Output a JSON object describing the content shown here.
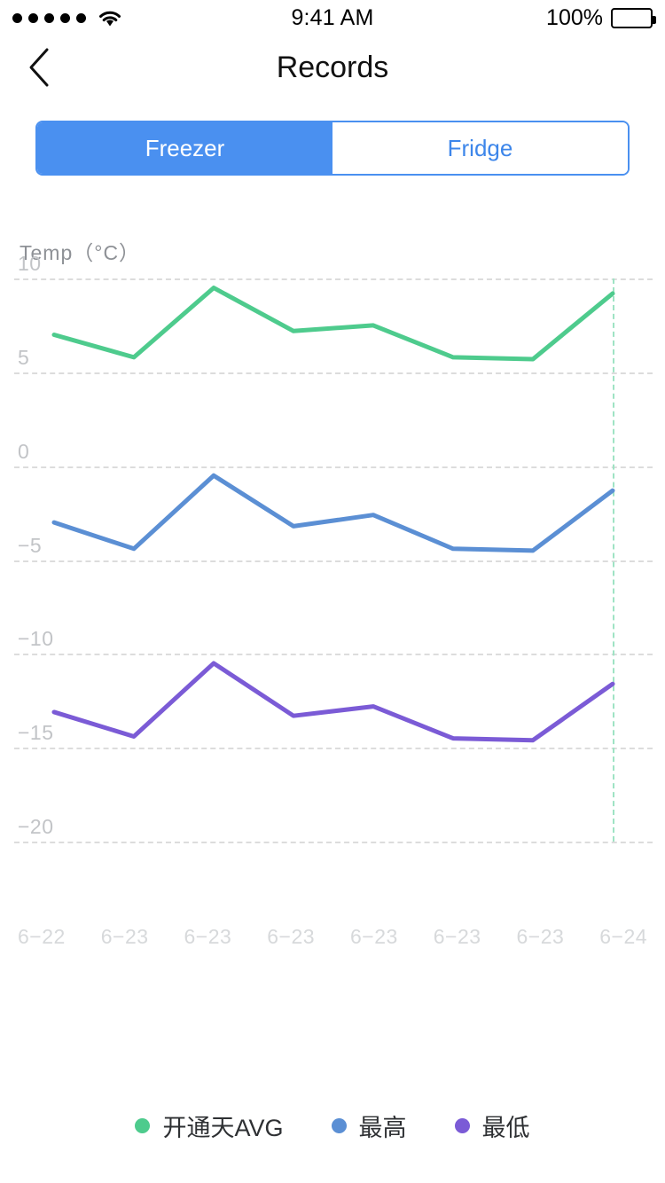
{
  "statusbar": {
    "signal_icon": "signal-dots",
    "wifi_icon": "wifi-icon",
    "time": "9:41 AM",
    "battery_percent": "100%",
    "battery_icon": "battery-full-icon"
  },
  "navbar": {
    "back_icon": "chevron-left-icon",
    "title": "Records"
  },
  "segmented": {
    "options": [
      {
        "label": "Freezer",
        "active": true
      },
      {
        "label": "Fridge",
        "active": false
      }
    ]
  },
  "colors": {
    "accent_blue": "#4a90f0",
    "avg_green": "#4ecb8d",
    "max_blue": "#5b8fd4",
    "min_purple": "#7b5bd6",
    "grid": "#dcdcdc",
    "marker": "#9fe3c4"
  },
  "chart_data": {
    "type": "line",
    "title": "",
    "ylabel": "Temp（°C）",
    "xlabel": "",
    "ylim": [
      -20,
      10
    ],
    "yticks": [
      10,
      5,
      0,
      -5,
      -10,
      -15,
      -20
    ],
    "ytick_labels": [
      "10",
      "5",
      "0",
      "−5",
      "−10",
      "−15",
      "−20"
    ],
    "grid": true,
    "legend_position": "bottom",
    "categories": [
      "6−22",
      "6−23",
      "6−23",
      "6−23",
      "6−23",
      "6−23",
      "6−23",
      "6−24"
    ],
    "marker_line_index": 7,
    "series": [
      {
        "name": "开通天AVG",
        "color": "#4ecb8d",
        "values": [
          7.0,
          5.8,
          9.5,
          7.2,
          7.5,
          5.8,
          5.7,
          9.2
        ]
      },
      {
        "name": "最高",
        "color": "#5b8fd4",
        "values": [
          -3.0,
          -4.4,
          -0.5,
          -3.2,
          -2.6,
          -4.4,
          -4.5,
          -1.3
        ]
      },
      {
        "name": "最低",
        "color": "#7b5bd6",
        "values": [
          -13.1,
          -14.4,
          -10.5,
          -13.3,
          -12.8,
          -14.5,
          -14.6,
          -11.6
        ]
      }
    ]
  }
}
